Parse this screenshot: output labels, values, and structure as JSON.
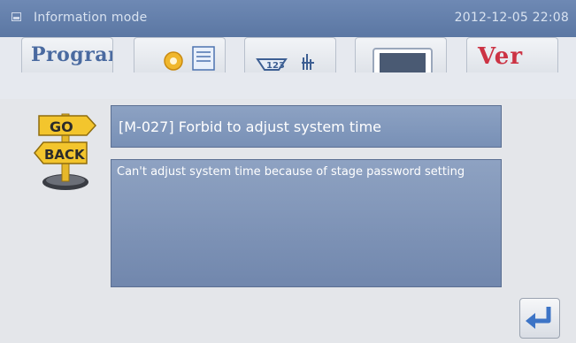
{
  "window": {
    "title": "Information mode",
    "datetime": "2012-12-05  22:08"
  },
  "toolbar": {
    "buttons": [
      {
        "name": "program",
        "label": "Program"
      },
      {
        "name": "settings",
        "label": ""
      },
      {
        "name": "counter",
        "label": "123"
      },
      {
        "name": "display",
        "label": ""
      },
      {
        "name": "version",
        "label": "Ver"
      }
    ]
  },
  "message": {
    "title": "[M-027] Forbid to adjust system time",
    "body": "Can't adjust system time because of stage password setting"
  },
  "signpost": {
    "go_label": "GO",
    "back_label": "BACK"
  },
  "icons": {
    "enter": "enter-arrow-icon",
    "app": "monitor-icon"
  },
  "colors": {
    "titlebar": "#5b77a3",
    "panel": "#7f95b9",
    "text": "#ffffff",
    "enter_arrow": "#3d74c6",
    "version_red": "#cc3344",
    "signpost_yellow": "#f3c52d"
  }
}
